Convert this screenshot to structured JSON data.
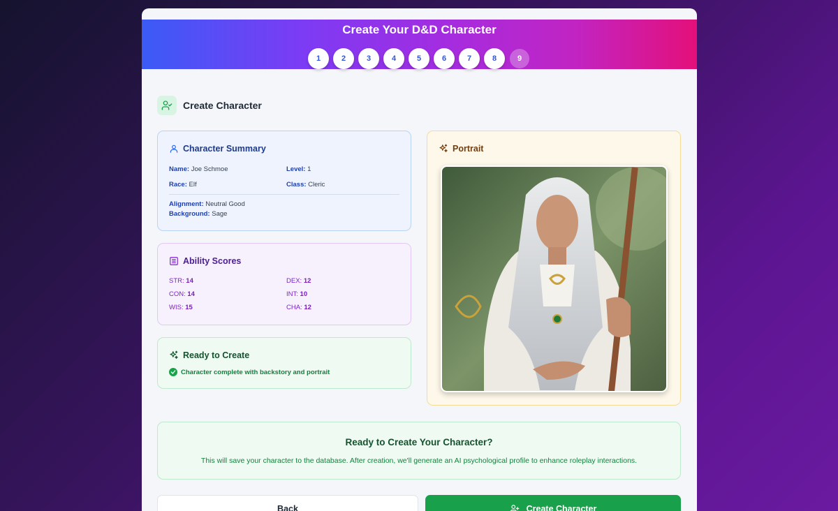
{
  "header": {
    "title": "Create Your D&D Character",
    "steps": [
      "1",
      "2",
      "3",
      "4",
      "5",
      "6",
      "7",
      "8",
      "9"
    ]
  },
  "section": {
    "title": "Create Character",
    "icon": "user-check-icon"
  },
  "summary": {
    "title": "Character Summary",
    "name_label": "Name:",
    "name": "Joe Schmoe",
    "level_label": "Level:",
    "level": "1",
    "race_label": "Race:",
    "race": "Elf",
    "class_label": "Class:",
    "class": "Cleric",
    "alignment_label": "Alignment:",
    "alignment": "Neutral Good",
    "background_label": "Background:",
    "background": "Sage"
  },
  "abilities": {
    "title": "Ability Scores",
    "items": [
      {
        "label": "STR:",
        "value": "14"
      },
      {
        "label": "DEX:",
        "value": "12"
      },
      {
        "label": "CON:",
        "value": "14"
      },
      {
        "label": "INT:",
        "value": "10"
      },
      {
        "label": "WIS:",
        "value": "15"
      },
      {
        "label": "CHA:",
        "value": "12"
      }
    ]
  },
  "ready": {
    "title": "Ready to Create",
    "status": "Character complete with backstory and portrait"
  },
  "portrait": {
    "title": "Portrait"
  },
  "cta": {
    "title": "Ready to Create Your Character?",
    "text": "This will save your character to the database. After creation, we'll generate an AI psychological profile to enhance roleplay interactions."
  },
  "buttons": {
    "back": "Back",
    "create": "Create Character"
  },
  "colors": {
    "accent_green": "#18a14a",
    "header_gradient_start": "#3b5bf6",
    "header_gradient_end": "#e4107a"
  }
}
